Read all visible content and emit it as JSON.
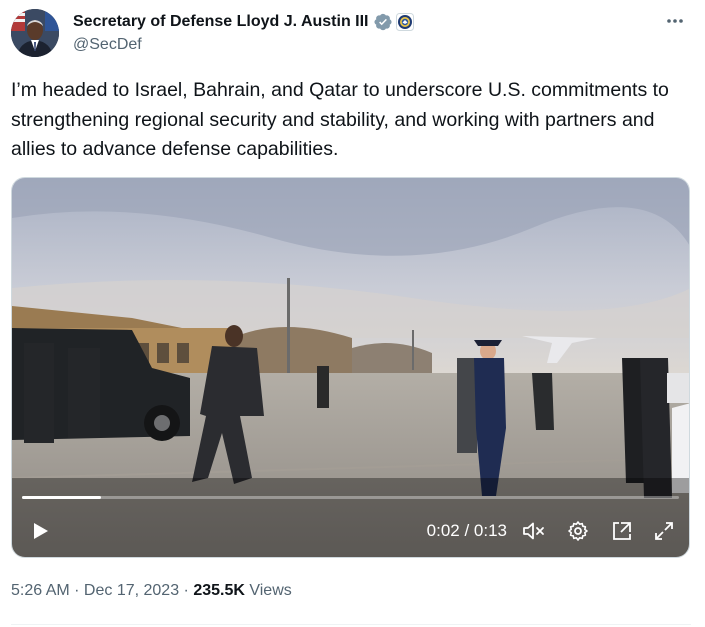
{
  "author": {
    "display_name": "Secretary of Defense Lloyd J. Austin III",
    "handle": "@SecDef",
    "avatar_icon": "profile-photo",
    "verified_icon": "verified-badge-icon",
    "affiliation_icon": "department-of-defense-seal-icon"
  },
  "more_icon": "more-options-icon",
  "tweet": {
    "text": "I’m headed to Israel, Bahrain, and Qatar to underscore U.S. commitments to strengthening regional security and stability, and working with partners and allies to advance defense capabilities."
  },
  "video": {
    "current_time": "0:02",
    "separator": " / ",
    "duration": "0:13",
    "progress_fraction": 0.12,
    "controls": [
      "play-icon",
      "mute-icon",
      "settings-icon",
      "pop-out-icon",
      "fullscreen-icon"
    ]
  },
  "meta": {
    "time": "5:26 AM",
    "dot1": " · ",
    "date": "Dec 17, 2023",
    "dot2": " · ",
    "views_count": "235.5K",
    "views_label": " Views"
  },
  "colors": {
    "verified": "#829aab",
    "text_primary": "#0f1419",
    "text_secondary": "#536471"
  }
}
